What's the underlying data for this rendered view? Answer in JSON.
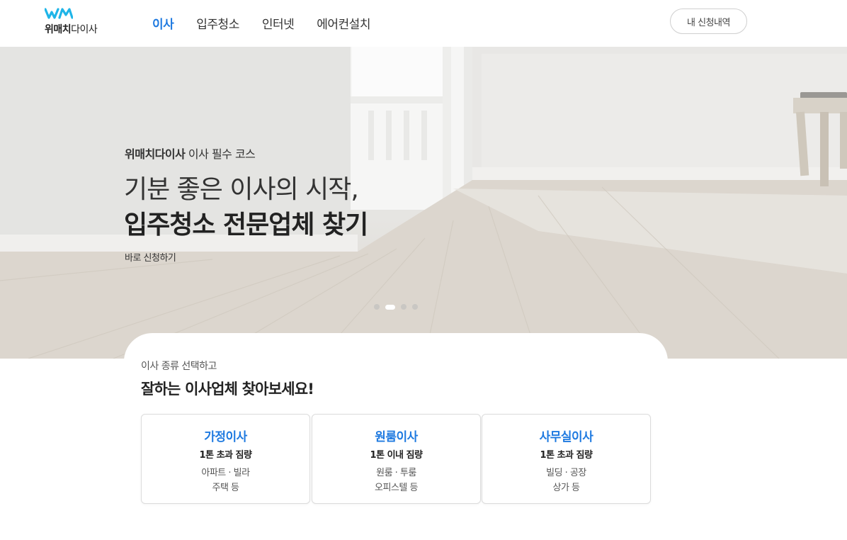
{
  "header": {
    "logo_brand": "위매치",
    "logo_suffix": "다이사",
    "nav": [
      {
        "label": "이사",
        "active": true
      },
      {
        "label": "입주청소",
        "active": false
      },
      {
        "label": "인터넷",
        "active": false
      },
      {
        "label": "에어컨설치",
        "active": false
      }
    ],
    "my_orders_label": "내 신청내역"
  },
  "hero": {
    "sub_brand": "위매치다이사",
    "sub_text": " 이사 필수 코스",
    "title_line1": "기분 좋은 이사의 시작,",
    "title_line2": "입주청소 전문업체 찾기",
    "cta": "바로 신청하기",
    "slides": 4,
    "active_slide": 2
  },
  "section": {
    "subtitle": "이사 종류 선택하고",
    "title": "잘하는 이사업체 찾아보세요!",
    "cards": [
      {
        "title": "가정이사",
        "weight": "1톤 초과 짐량",
        "desc1": "아파트 · 빌라",
        "desc2": "주택 등"
      },
      {
        "title": "원룸이사",
        "weight": "1톤 이내 짐량",
        "desc1": "원룸 · 투룸",
        "desc2": "오피스텔 등"
      },
      {
        "title": "사무실이사",
        "weight": "1톤 초과 짐량",
        "desc1": "빌딩 · 공장",
        "desc2": "상가 등"
      }
    ]
  },
  "colors": {
    "accent": "#1f7ae0",
    "logo": "#1fb5e8",
    "text": "#222222"
  }
}
